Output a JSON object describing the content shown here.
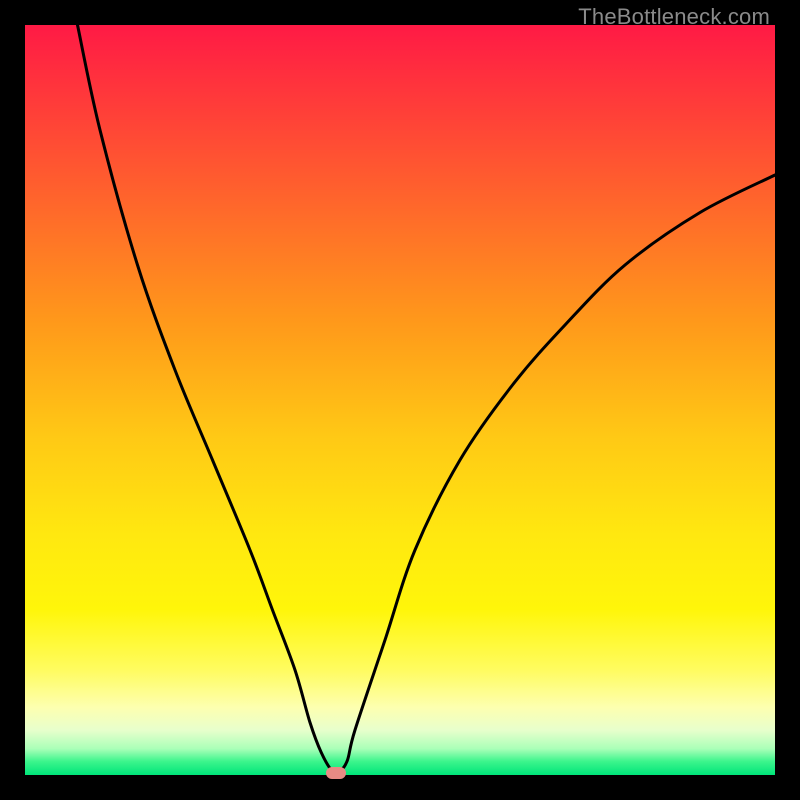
{
  "watermark": "TheBottleneck.com",
  "colors": {
    "frame": "#000000",
    "curve": "#000000",
    "marker": "#e78a84"
  },
  "chart_data": {
    "type": "line",
    "title": "",
    "xlabel": "",
    "ylabel": "",
    "xlim": [
      0,
      100
    ],
    "ylim": [
      0,
      100
    ],
    "series": [
      {
        "name": "curve",
        "x": [
          7,
          10,
          15,
          20,
          25,
          30,
          33,
          36,
          38,
          39.5,
          41,
          42,
          43,
          44,
          48,
          52,
          58,
          65,
          72,
          80,
          90,
          100
        ],
        "y": [
          100,
          86,
          68,
          54,
          42,
          30,
          22,
          14,
          7,
          3,
          0.5,
          0.5,
          2,
          6,
          18,
          30,
          42,
          52,
          60,
          68,
          75,
          80
        ]
      }
    ],
    "markers": [
      {
        "name": "bottom-marker",
        "x": 41.5,
        "y": 0.3
      }
    ],
    "background_gradient": {
      "top": "#ff1a45",
      "mid": "#fff60a",
      "bottom": "#00e57a"
    }
  }
}
